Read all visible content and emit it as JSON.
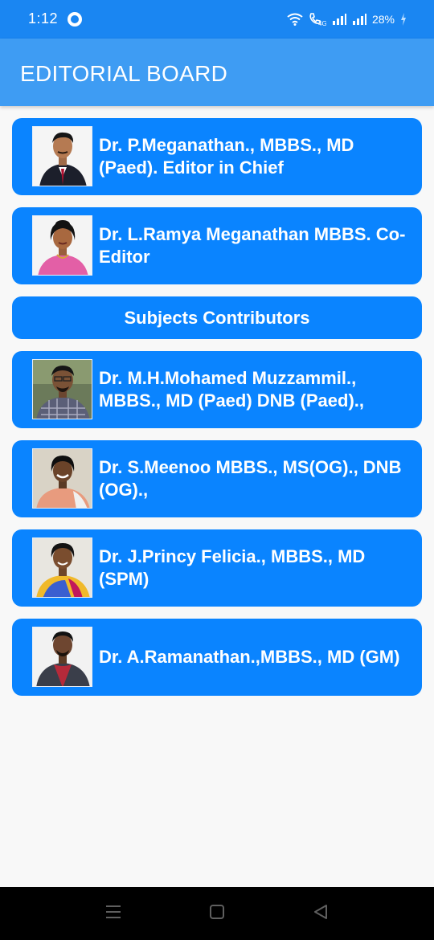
{
  "status_bar": {
    "time": "1:12",
    "battery": "28%"
  },
  "app_bar": {
    "title": "EDITORIAL BOARD"
  },
  "cards": [
    {
      "type": "person",
      "name": "Dr. P.Meganathan., MBBS., MD (Paed). Editor in Chief"
    },
    {
      "type": "person",
      "name": "Dr. L.Ramya Meganathan MBBS. Co-Editor"
    },
    {
      "type": "section",
      "label": "Subjects Contributors"
    },
    {
      "type": "person",
      "name": "Dr. M.H.Mohamed Muzzammil., MBBS., MD (Paed) DNB (Paed).,"
    },
    {
      "type": "person",
      "name": "Dr. S.Meenoo MBBS., MS(OG)., DNB (OG).,"
    },
    {
      "type": "person",
      "name": "Dr. J.Princy Felicia.,  MBBS., MD (SPM)"
    },
    {
      "type": "person",
      "name": "Dr. A.Ramanathan.,MBBS., MD (GM)"
    }
  ],
  "colors": {
    "status_bar": "#1a86f2",
    "app_bar": "#3e9cf3",
    "card": "#0a84ff",
    "background": "#f8f8f8"
  }
}
